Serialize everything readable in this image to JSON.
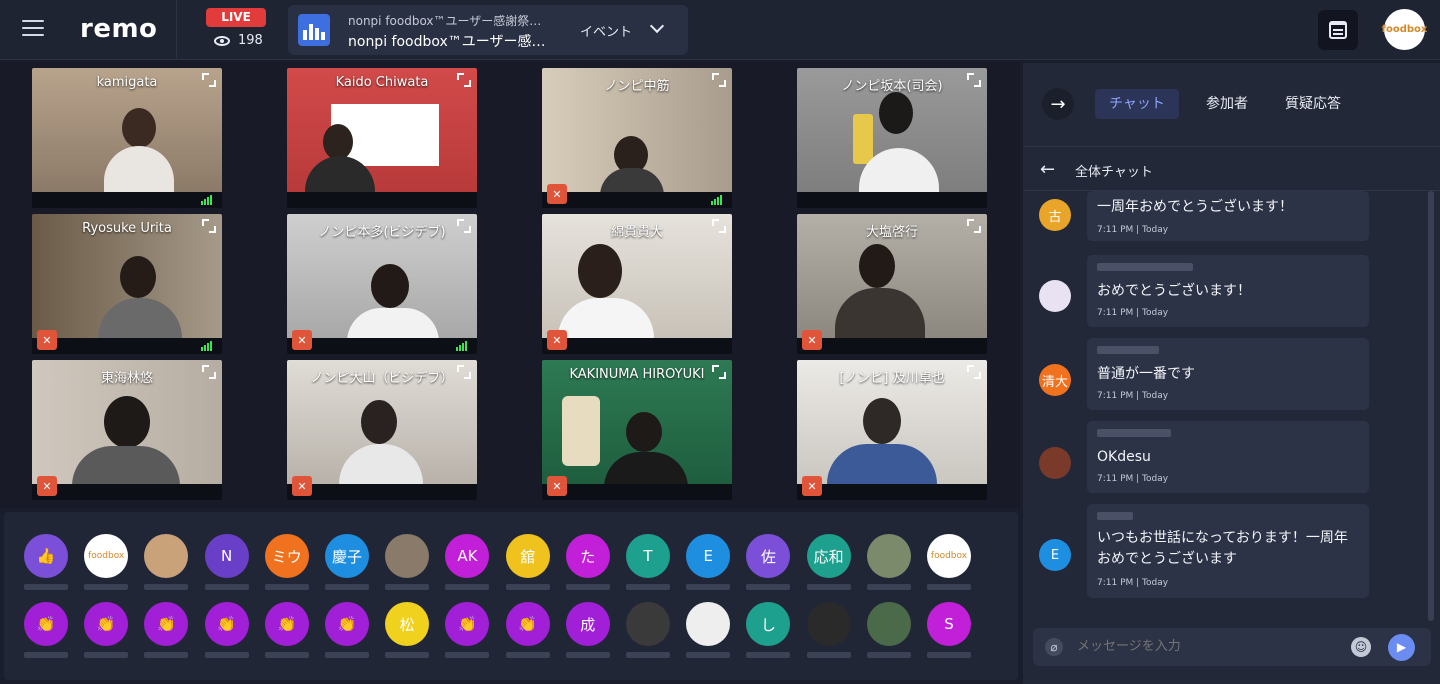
{
  "header": {
    "logo": "remo",
    "live_label": "LIVE",
    "viewer_count": "198",
    "event_subtitle": "nonpi foodbox™ユーザー感謝祭…",
    "event_title": "nonpi foodbox™ユーザー感…",
    "event_type": "イベント",
    "profile_avatar_text": "foodbox",
    "colors": {
      "live": "#e23b3b",
      "accent": "#3d6fe0",
      "topbar": "#1f2433"
    }
  },
  "stage": {
    "tiles": [
      {
        "name": "kamigata",
        "muted": false
      },
      {
        "name": "Kaido Chiwata",
        "muted": false
      },
      {
        "name": "ノンピ中筋",
        "muted": true
      },
      {
        "name": "ノンピ坂本(司会)",
        "muted": false
      },
      {
        "name": "Ryosuke Urita",
        "muted": true
      },
      {
        "name": "ノンピ本多(ビジデブ)",
        "muted": true
      },
      {
        "name": "綿貫貴大",
        "muted": true
      },
      {
        "name": "大塩啓行",
        "muted": true
      },
      {
        "name": "東海林悠",
        "muted": true
      },
      {
        "name": "ノンピ大山（ビジデブ）",
        "muted": true
      },
      {
        "name": "KAKINUMA HIROYUKI",
        "muted": true
      },
      {
        "name": "[ノンピ] 及川卓也",
        "muted": true
      }
    ]
  },
  "audience": {
    "row1": [
      "👍",
      "foodbox",
      "",
      "N",
      "ミウ",
      "慶子",
      "",
      "AK",
      "舘",
      "た",
      "T",
      "E",
      "佐",
      "応和",
      "",
      "foodbox"
    ],
    "row2": [
      "👏",
      "👏",
      "👏",
      "👏",
      "👏",
      "👏",
      "松",
      "👏",
      "👏",
      "成",
      "",
      "",
      "し",
      "",
      "",
      "S"
    ]
  },
  "chat": {
    "tabs": [
      "チャット",
      "参加者",
      "質疑応答"
    ],
    "subheader": "全体チャット",
    "messages": [
      {
        "avatar": "古",
        "text": "一周年おめでとうございます！",
        "time": "7:11 PM | Today"
      },
      {
        "avatar": "",
        "text": "おめでとうございます！",
        "time": "7:11 PM | Today"
      },
      {
        "avatar": "清大",
        "text": "普通が一番です",
        "time": "7:11 PM | Today"
      },
      {
        "avatar": "",
        "text": "OKdesu",
        "time": "7:11 PM | Today"
      },
      {
        "avatar": "E",
        "text": "いつもお世話になっております！一周年おめでとうございます",
        "time": "7:11 PM | Today"
      }
    ],
    "input_placeholder": "メッセージを入力"
  }
}
